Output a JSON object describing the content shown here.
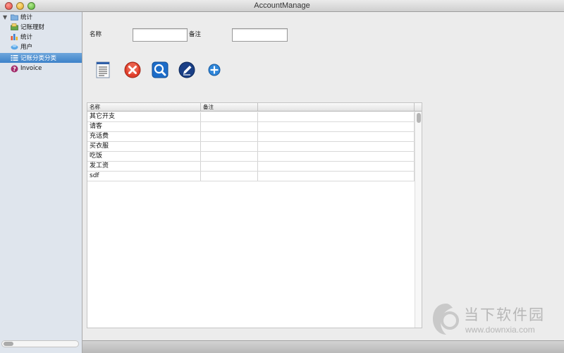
{
  "window": {
    "title": "AccountManage"
  },
  "sidebar": {
    "items": [
      {
        "label": "统计",
        "icon": "folder-icon",
        "selected": false
      },
      {
        "label": "记账理财",
        "icon": "ledger-icon",
        "selected": false
      },
      {
        "label": "统计",
        "icon": "bar-chart-icon",
        "selected": false
      },
      {
        "label": "用户",
        "icon": "users-icon",
        "selected": false
      },
      {
        "label": "记账分类分类",
        "icon": "category-list-icon",
        "selected": true
      },
      {
        "label": "Invoice",
        "icon": "question-icon",
        "selected": false
      }
    ]
  },
  "form": {
    "name_label": "名称",
    "name_value": "",
    "note_label": "备注",
    "note_value": ""
  },
  "toolbar": {
    "icons": [
      "document-icon",
      "delete-icon",
      "search-icon",
      "edit-icon",
      "add-icon"
    ]
  },
  "table": {
    "columns": [
      "名称",
      "备注",
      ""
    ],
    "rows": [
      {
        "name": "其它开支",
        "note": "",
        "extra": ""
      },
      {
        "name": "请客",
        "note": "",
        "extra": ""
      },
      {
        "name": "充话费",
        "note": "",
        "extra": ""
      },
      {
        "name": "买衣服",
        "note": "",
        "extra": ""
      },
      {
        "name": "吃饭",
        "note": "",
        "extra": ""
      },
      {
        "name": "发工资",
        "note": "",
        "extra": ""
      },
      {
        "name": "sdf",
        "note": "",
        "extra": ""
      }
    ]
  },
  "watermark": {
    "name": "当下软件园",
    "url": "www.downxia.com"
  },
  "colors": {
    "selection": "#3d82c9",
    "sidebar_bg": "#dfe5ed",
    "window_bg": "#ececec"
  }
}
